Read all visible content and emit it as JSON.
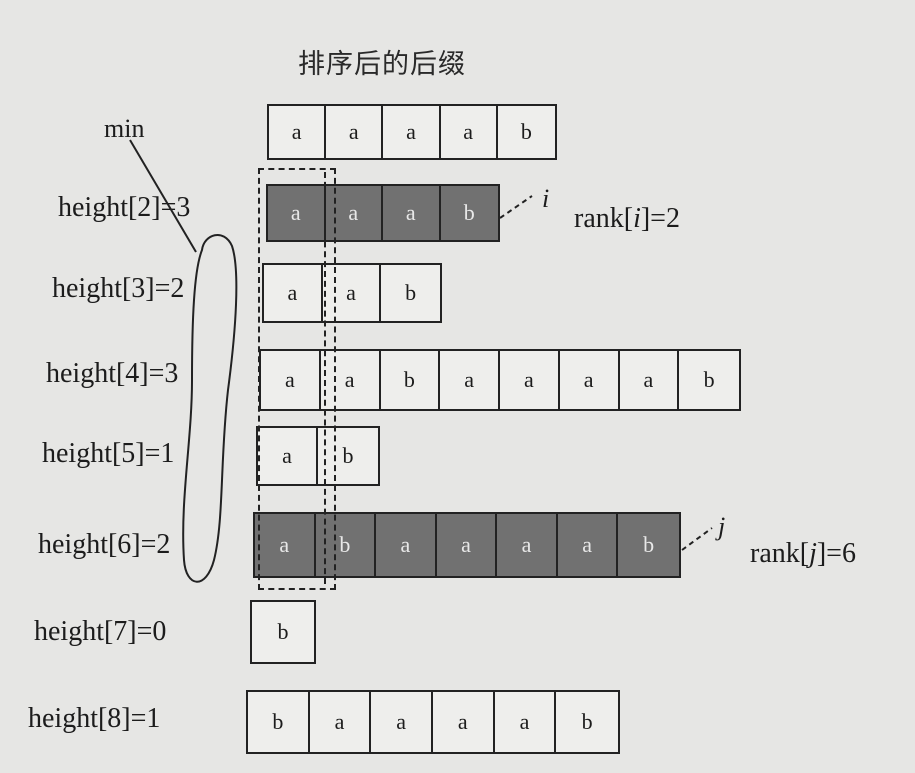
{
  "title": "排序后的后缀",
  "min_label": "min",
  "rows": [
    {
      "height_label": "",
      "chars": [
        "a",
        "a",
        "a",
        "a",
        "b"
      ],
      "shaded": false
    },
    {
      "height_label": "height[2]=3",
      "chars": [
        "a",
        "a",
        "a",
        "b"
      ],
      "shaded": true
    },
    {
      "height_label": "height[3]=2",
      "chars": [
        "a",
        "a",
        "b"
      ],
      "shaded": false
    },
    {
      "height_label": "height[4]=3",
      "chars": [
        "a",
        "a",
        "b",
        "a",
        "a",
        "a",
        "a",
        "b"
      ],
      "shaded": false
    },
    {
      "height_label": "height[5]=1",
      "chars": [
        "a",
        "b"
      ],
      "shaded": false
    },
    {
      "height_label": "height[6]=2",
      "chars": [
        "a",
        "b",
        "a",
        "a",
        "a",
        "a",
        "b"
      ],
      "shaded": true
    },
    {
      "height_label": "height[7]=0",
      "chars": [
        "b"
      ],
      "shaded": false
    },
    {
      "height_label": "height[8]=1",
      "chars": [
        "b",
        "a",
        "a",
        "a",
        "a",
        "b"
      ],
      "shaded": false
    }
  ],
  "annotations": {
    "i_symbol": "i",
    "j_symbol": "j",
    "rank_i": {
      "prefix": "rank[",
      "var": "i",
      "suffix": "]=2"
    },
    "rank_j": {
      "prefix": "rank[",
      "var": "j",
      "suffix": "]=6"
    }
  }
}
